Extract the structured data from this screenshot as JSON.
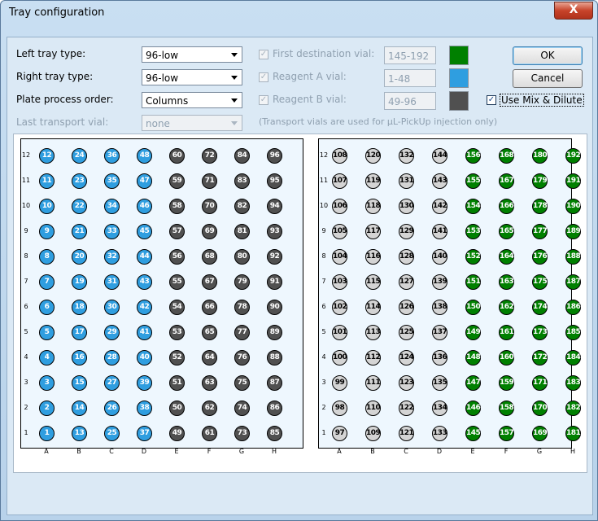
{
  "window": {
    "title": "Tray configuration",
    "close_label": "X"
  },
  "form": {
    "left_tray_label": "Left tray type:",
    "left_tray_value": "96-low",
    "right_tray_label": "Right tray type:",
    "right_tray_value": "96-low",
    "plate_order_label": "Plate process order:",
    "plate_order_value": "Columns",
    "last_vial_label": "Last transport vial:",
    "last_vial_value": "none",
    "first_dest_label": "First destination vial:",
    "first_dest_value": "145-192",
    "first_dest_color": "#008000",
    "reagent_a_label": "Reagent A vial:",
    "reagent_a_value": "1-48",
    "reagent_a_color": "#2f9ee0",
    "reagent_b_label": "Reagent B vial:",
    "reagent_b_value": "49-96",
    "reagent_b_color": "#505050",
    "transport_note": "(Transport vials are used for µL-PickUp injection only)",
    "mix_dilute_label": "Use Mix & Dilute",
    "mix_dilute_checked": true
  },
  "buttons": {
    "ok": "OK",
    "cancel": "Cancel"
  },
  "tray": {
    "rows": [
      "12",
      "11",
      "10",
      "9",
      "8",
      "7",
      "6",
      "5",
      "4",
      "3",
      "2",
      "1"
    ],
    "columns": [
      "A",
      "B",
      "C",
      "D",
      "E",
      "F",
      "G",
      "H"
    ],
    "colors": {
      "reagent_a": "#2f9ee0",
      "reagent_b": "#505050",
      "empty": "#d4d4d4",
      "destination": "#008000"
    }
  }
}
